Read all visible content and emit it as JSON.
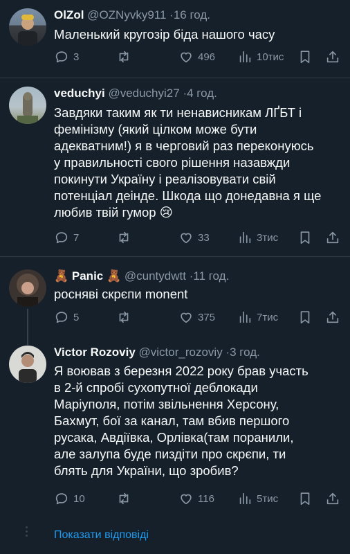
{
  "tweets": [
    {
      "name": "OlZol",
      "handle": "@OZNyvky911",
      "time": "16 год.",
      "text": "Маленький кругозір біда нашого часу",
      "replies": "3",
      "retweets": "",
      "likes": "496",
      "views": "10тис"
    },
    {
      "name": "veduchyi",
      "handle": "@veduchyi27",
      "time": "4 год.",
      "text": "Завдяки таким як ти ненависникам ЛҐБТ і\nфемінізму (який цілком може бути\nадекватним!) я в черговий раз переконуюсь\nу правильності свого рішення назавжди\nпокинути Україну і реалізовувати свій\nпотенціал деінде. Шкода що донедавна я ще\nлюбив твій гумор 😢",
      "replies": "7",
      "retweets": "",
      "likes": "33",
      "views": "3тис"
    },
    {
      "name": "🧸 Panic 🧸",
      "handle": "@cuntydwtt",
      "time": "11 год.",
      "text": "росняві скрєпи monent",
      "replies": "5",
      "retweets": "",
      "likes": "375",
      "views": "7тис"
    },
    {
      "name": "Victor Rozoviy",
      "handle": "@victor_rozoviy",
      "time": "3 год.",
      "text": "Я воював з березня 2022 року брав участь\nв 2-й спробі сухопутної деблокади\nМаріуполя,  потім звільнення Херсону,\nБахмут, бої за канал, там вбив першого\nрусака, Авдіївка, Орлівка(там поранили,\nале залупа буде пиздіти про скрєпи, ти\nблять для України, що зробив?",
      "replies": "10",
      "retweets": "",
      "likes": "116",
      "views": "5тис"
    }
  ],
  "show_replies": "Показати відповіді",
  "colors": {
    "background": "#15202b",
    "accent": "#1d9bf0",
    "muted": "#8b98a5"
  }
}
